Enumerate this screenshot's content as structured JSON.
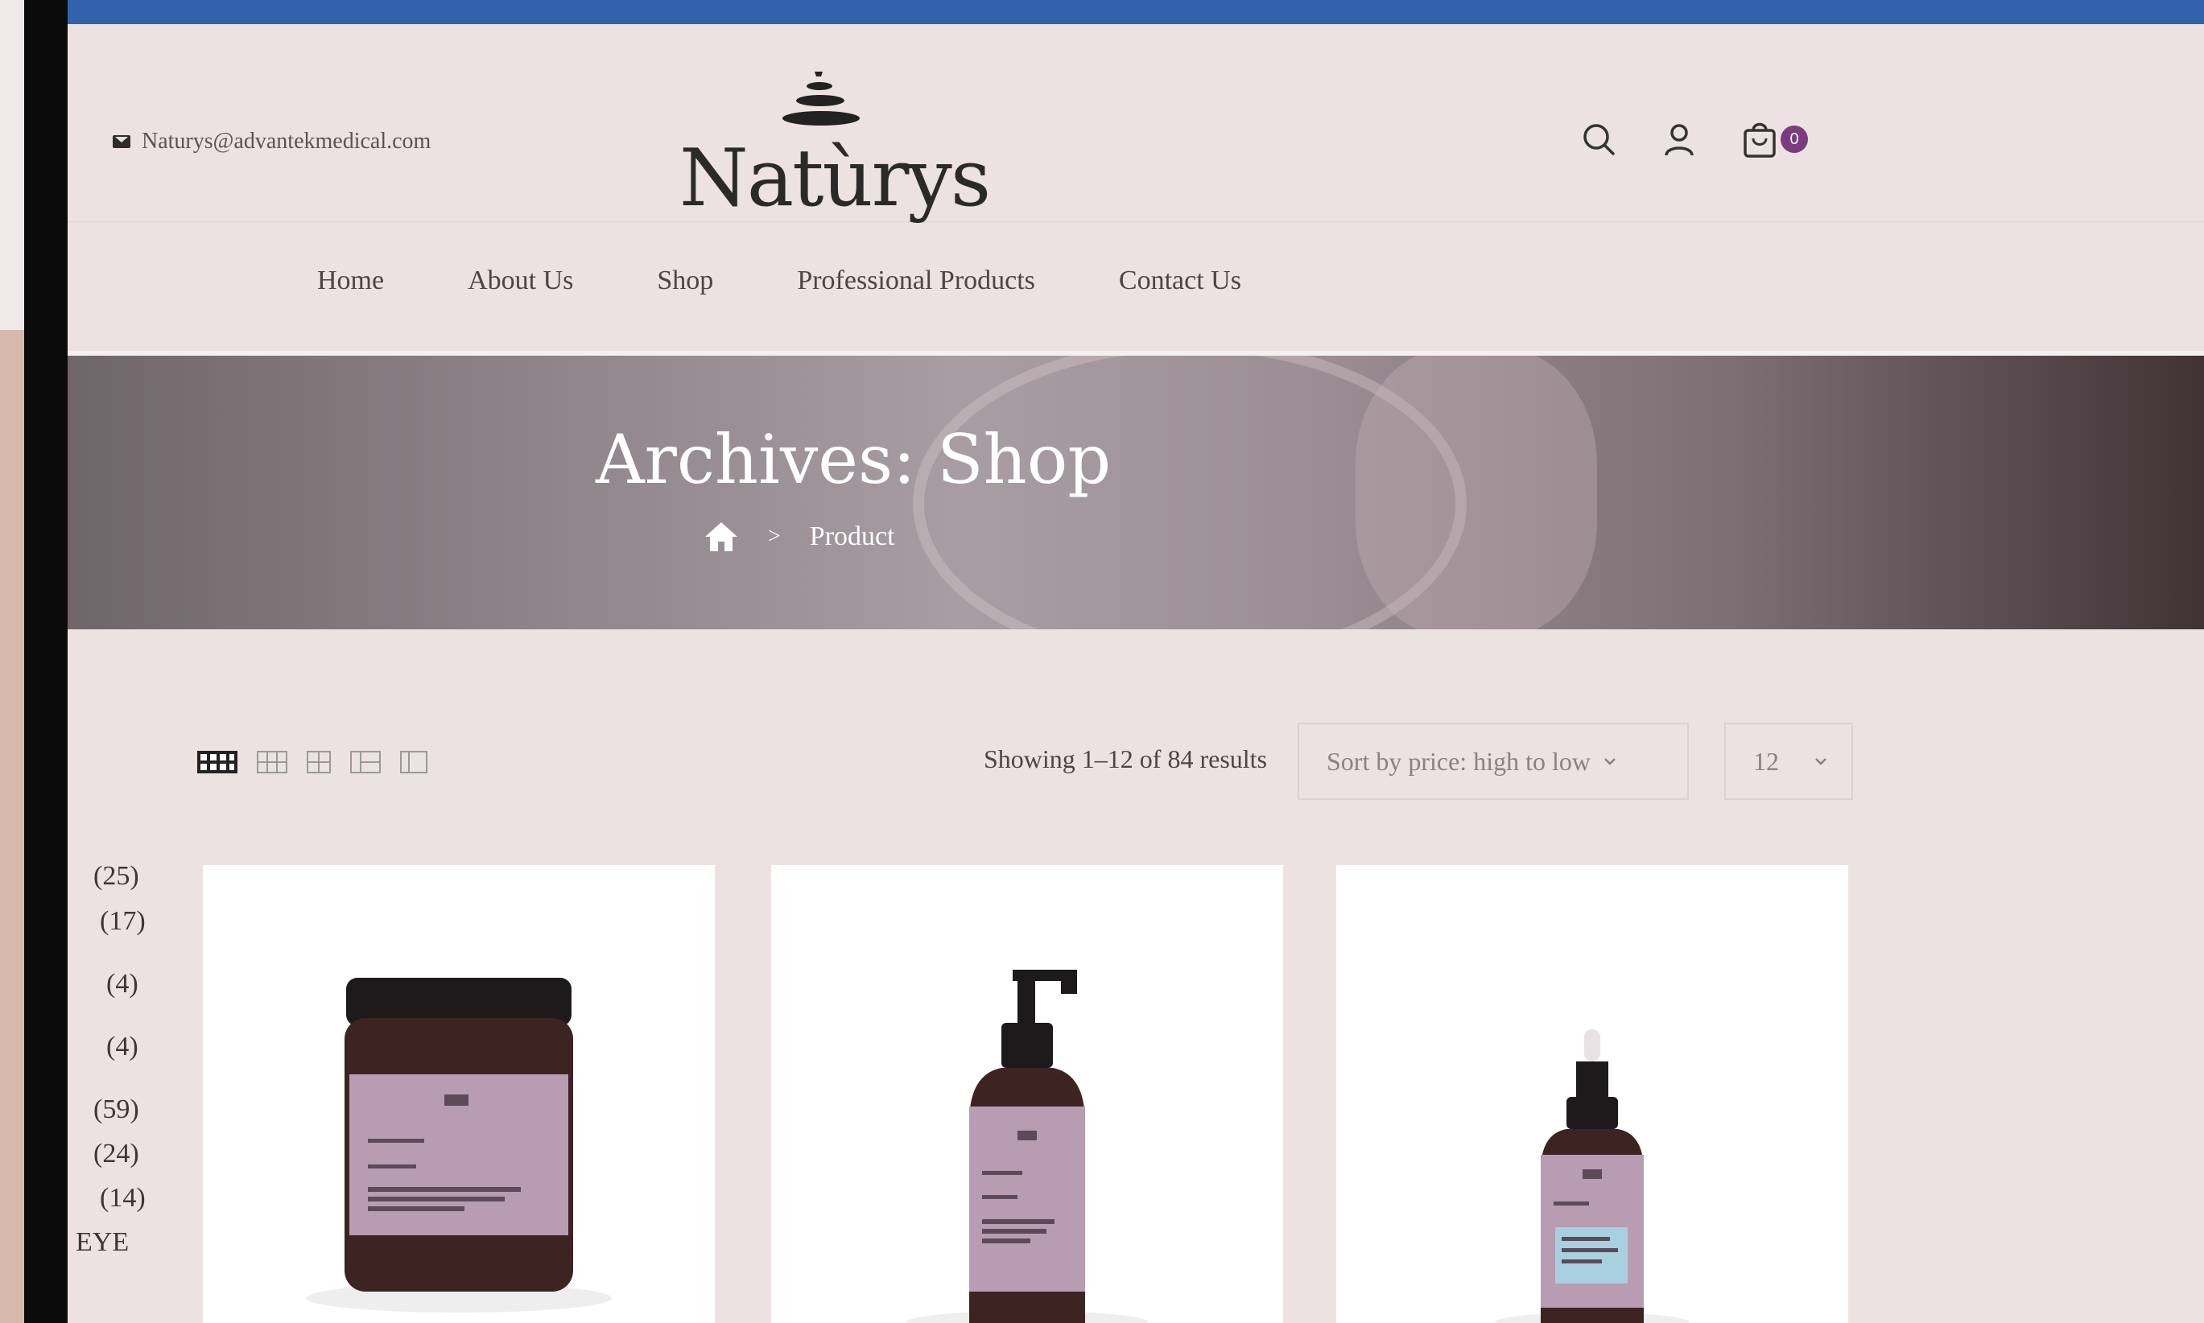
{
  "header": {
    "email": "Naturys@advantekmedical.com",
    "brand": "Natùrys",
    "cart_count": "0",
    "icons": [
      "search-icon",
      "user-icon",
      "cart-icon"
    ]
  },
  "nav": {
    "items": [
      "Home",
      "About Us",
      "Shop",
      "Professional Products",
      "Contact Us"
    ]
  },
  "hero": {
    "title": "Archives: Shop",
    "breadcrumb_separator": ">",
    "breadcrumb_current": "Product"
  },
  "toolbar": {
    "results": "Showing 1–12 of 84 results",
    "sort_value": "Sort by price: high to low",
    "per_page_value": "12"
  },
  "sidebar": {
    "counts": [
      "(25)",
      "(17)",
      "(4)",
      "(4)",
      "(59)",
      "(24)",
      "(14)"
    ],
    "partial_label": "EYE"
  },
  "colors": {
    "topbar": "#3362ad",
    "page_bg": "#ede2e2",
    "badge": "#7b3b7e",
    "label_lilac": "#b79cb2"
  }
}
